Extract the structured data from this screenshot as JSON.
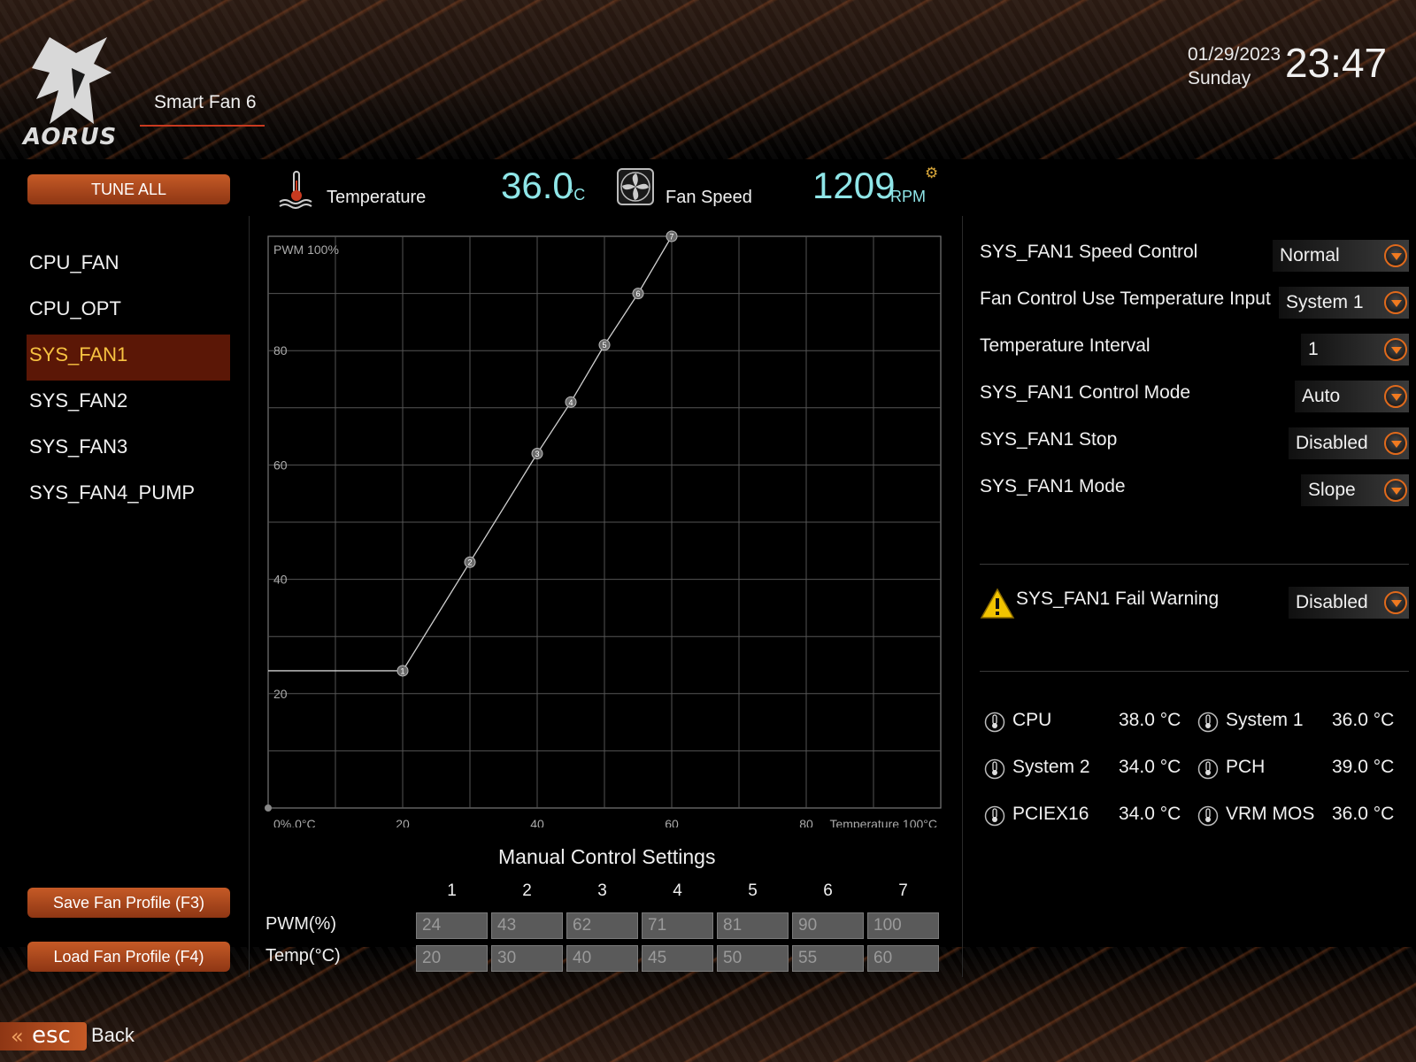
{
  "header": {
    "logo_text": "AORUS",
    "page_title": "Smart Fan 6",
    "date": "01/29/2023",
    "day": "Sunday",
    "time": "23:47"
  },
  "sidebar": {
    "tune_all_label": "TUNE ALL",
    "fans": [
      {
        "label": "CPU_FAN",
        "active": false
      },
      {
        "label": "CPU_OPT",
        "active": false
      },
      {
        "label": "SYS_FAN1",
        "active": true
      },
      {
        "label": "SYS_FAN2",
        "active": false
      },
      {
        "label": "SYS_FAN3",
        "active": false
      },
      {
        "label": "SYS_FAN4_PUMP",
        "active": false
      }
    ],
    "save_label": "Save Fan Profile (F3)",
    "load_label": "Load Fan Profile (F4)"
  },
  "readouts": {
    "temperature_label": "Temperature",
    "temperature_value": "36.0",
    "temperature_unit": "°C",
    "fan_speed_label": "Fan Speed",
    "fan_speed_value": "1209",
    "fan_speed_unit": "RPM"
  },
  "chart_data": {
    "type": "line",
    "ylabel": "PWM 100%",
    "xlabel": "Temperature 100°C",
    "origin_label": "0%,0°C",
    "x_ticks": [
      "20",
      "40",
      "60",
      "80"
    ],
    "y_ticks": [
      "20",
      "40",
      "60",
      "80"
    ],
    "xlim": [
      0,
      100
    ],
    "ylim": [
      0,
      100
    ],
    "grid": true,
    "points": [
      {
        "id": "1",
        "x": 20,
        "y": 24
      },
      {
        "id": "2",
        "x": 30,
        "y": 43
      },
      {
        "id": "3",
        "x": 40,
        "y": 62
      },
      {
        "id": "4",
        "x": 45,
        "y": 71
      },
      {
        "id": "5",
        "x": 50,
        "y": 81
      },
      {
        "id": "6",
        "x": 55,
        "y": 90
      },
      {
        "id": "7",
        "x": 60,
        "y": 100
      }
    ]
  },
  "manual": {
    "title": "Manual Control Settings",
    "columns": [
      "1",
      "2",
      "3",
      "4",
      "5",
      "6",
      "7"
    ],
    "pwm_label": "PWM(%)",
    "temp_label": "Temp(°C)",
    "pwm": [
      "24",
      "43",
      "62",
      "71",
      "81",
      "90",
      "100"
    ],
    "temp": [
      "20",
      "30",
      "40",
      "45",
      "50",
      "55",
      "60"
    ]
  },
  "settings": [
    {
      "label": "SYS_FAN1 Speed Control",
      "value": "Normal"
    },
    {
      "label": "Fan Control Use Temperature Input",
      "value": "System 1"
    },
    {
      "label": "Temperature Interval",
      "value": "1"
    },
    {
      "label": "SYS_FAN1 Control Mode",
      "value": "Auto"
    },
    {
      "label": "SYS_FAN1 Stop",
      "value": "Disabled"
    },
    {
      "label": "SYS_FAN1 Mode",
      "value": "Slope"
    }
  ],
  "fail_warning": {
    "label": "SYS_FAN1 Fail Warning",
    "value": "Disabled"
  },
  "sensors": [
    {
      "name": "CPU",
      "value": "38.0 °C"
    },
    {
      "name": "System 1",
      "value": "36.0 °C"
    },
    {
      "name": "System 2",
      "value": "34.0 °C"
    },
    {
      "name": "PCH",
      "value": "39.0 °C"
    },
    {
      "name": "PCIEX16",
      "value": "34.0 °C"
    },
    {
      "name": "VRM MOS",
      "value": "36.0 °C"
    }
  ],
  "footer": {
    "esc_label": "esc",
    "back_label": "Back"
  },
  "colors": {
    "accent": "#c55a26",
    "active_text": "#f7c241",
    "readout": "#8fe6e8"
  }
}
